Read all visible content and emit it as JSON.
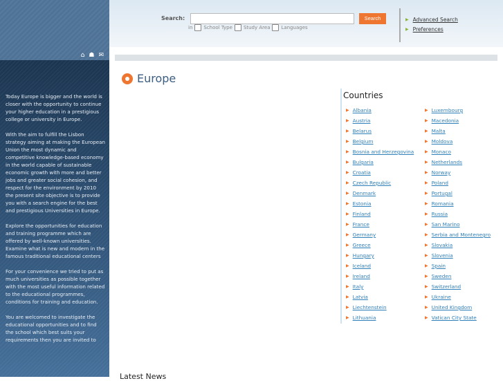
{
  "search": {
    "label": "Search:",
    "value": "",
    "button": "Search",
    "in_label": "in",
    "options": [
      "School Type",
      "Study Area",
      "Languages"
    ]
  },
  "header_links": [
    "Advanced Search",
    "Preferences"
  ],
  "side_icons": [
    "home-icon",
    "sitemap-icon",
    "mail-icon"
  ],
  "sidebar_paragraphs": [
    "Today Europe is bigger and the world is closer with the opportunity to continue your higher education in a prestigious college or university in Europe.",
    "With the aim to fulfill the Lisbon strategy aiming at making the European Union the most dynamic and competitive knowledge-based economy in the world capable of sustainable economic growth with more and better jobs and greater social cohesion, and respect for the environment by 2010 the present site objective is to provide you with a search engine for the best and prestigious Universities in Europe.",
    "Explore the opportunities for education and training programme which are offered by well-known universities. Examine what is new and modern in the famous traditional educational centers",
    "For your convenience we tried to put as much universities as possible together with the most useful information related to the educational programmes, conditions for training and education.",
    "You are welcomed to investigate the educational opportunities and to find the school which best suits your requirements then you are invited to"
  ],
  "page_title": "Europe",
  "countries_title": "Countries",
  "countries": [
    "Albania",
    "Austria",
    "Belarus",
    "Belgium",
    "Bosnia and Herzegovina",
    "Bulgaria",
    "Croatia",
    "Czech Republic",
    "Denmark",
    "Estonia",
    "Finland",
    "France",
    "Germany",
    "Greece",
    "Hungary",
    "Iceland",
    "Ireland",
    "Italy",
    "Latvia",
    "Liechtenstein",
    "Lithuania",
    "Luxembourg",
    "Macedonia",
    "Malta",
    "Moldova",
    "Monaco",
    "Netherlands",
    "Norway",
    "Poland",
    "Portugal",
    "Romania",
    "Russia",
    "San Marino",
    "Serbia and Montenegro",
    "Slovakia",
    "Slovenia",
    "Spain",
    "Sweden",
    "Switzerland",
    "Ukraine",
    "United Kingdom",
    "Vatican City State"
  ],
  "latest_news": "Latest News"
}
